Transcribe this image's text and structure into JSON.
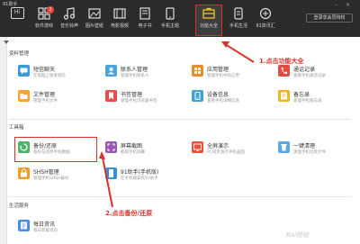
{
  "app_title": "91助手",
  "nav": [
    {
      "label": "",
      "icon": "hi-icon"
    },
    {
      "label": "软件游戏",
      "icon": "grid-icon",
      "badge": "2"
    },
    {
      "label": "音乐铃声",
      "icon": "music-icon"
    },
    {
      "label": "图片壁纸",
      "icon": "image-icon"
    },
    {
      "label": "电影视频",
      "icon": "film-icon"
    },
    {
      "label": "电子书",
      "icon": "book-icon"
    },
    {
      "label": "手机主题",
      "icon": "theme-icon"
    },
    {
      "label": "功能大全",
      "icon": "toolbox-icon"
    },
    {
      "label": "手机生活",
      "icon": "phone-life-icon"
    },
    {
      "label": "91资讯汇",
      "icon": "news-icon"
    }
  ],
  "login": "登录享会员特权",
  "sections": {
    "data": "资料管理",
    "tools": "工具箱",
    "life": "生活服务"
  },
  "cards": [
    {
      "name": "短信聊天",
      "desc": "在电脑上收发短信",
      "color": "#3a9ad9",
      "icon": "sms-icon"
    },
    {
      "name": "联系人管理",
      "desc": "管理手机联系人",
      "color": "#4aa3df",
      "icon": "contacts-icon"
    },
    {
      "name": "应用管理",
      "desc": "管理手机中的应用",
      "color": "#f08a24",
      "icon": "app-icon"
    },
    {
      "name": "通话记录",
      "desc": "查看手机通话记录",
      "color": "#e34b3e",
      "icon": "call-log-icon"
    },
    {
      "name": "文件管理",
      "desc": "管理手机文件",
      "color": "#f3a732",
      "icon": "folder-icon"
    },
    {
      "name": "书签管理",
      "desc": "管理手机浏览器书签",
      "color": "#e84d4d",
      "icon": "bookmark-icon"
    },
    {
      "name": "设备信息",
      "desc": "查看手机详细信息",
      "color": "#3fa0db",
      "icon": "device-info-icon"
    },
    {
      "name": "备忘录",
      "desc": "管理手机备忘录",
      "color": "#f0b429",
      "icon": "memo-icon"
    },
    {
      "name": "备份/还原",
      "desc": "备份与还原手机数据",
      "color": "#4db36a",
      "icon": "backup-icon"
    },
    {
      "name": "屏幕截图",
      "desc": "截取手机屏幕",
      "color": "#9b59b6",
      "icon": "screenshot-icon"
    },
    {
      "name": "全屏演示",
      "desc": "PC同步演示手机画面",
      "color": "#e8503a",
      "icon": "fullscreen-icon"
    },
    {
      "name": "一键清理",
      "desc": "清理手机垃圾文件",
      "color": "#5aa9e6",
      "icon": "cleanup-icon"
    },
    {
      "name": "SHSH管理",
      "desc": "管理手机SHSH备份",
      "color": "#f29b2b",
      "icon": "shsh-icon"
    },
    {
      "name": "91助手(手机版)",
      "desc": "在手机端安装91助手",
      "color": "#3b8fd9",
      "icon": "phone-app-icon"
    },
    {
      "name": "每日资讯",
      "desc": "每日新鲜资讯",
      "color": "#4a90d9",
      "icon": "daily-news-icon"
    }
  ],
  "annotations": {
    "step1": "1.点击功能大全",
    "step2": "2.点击备份/还原"
  },
  "watermark": "Bai经验"
}
